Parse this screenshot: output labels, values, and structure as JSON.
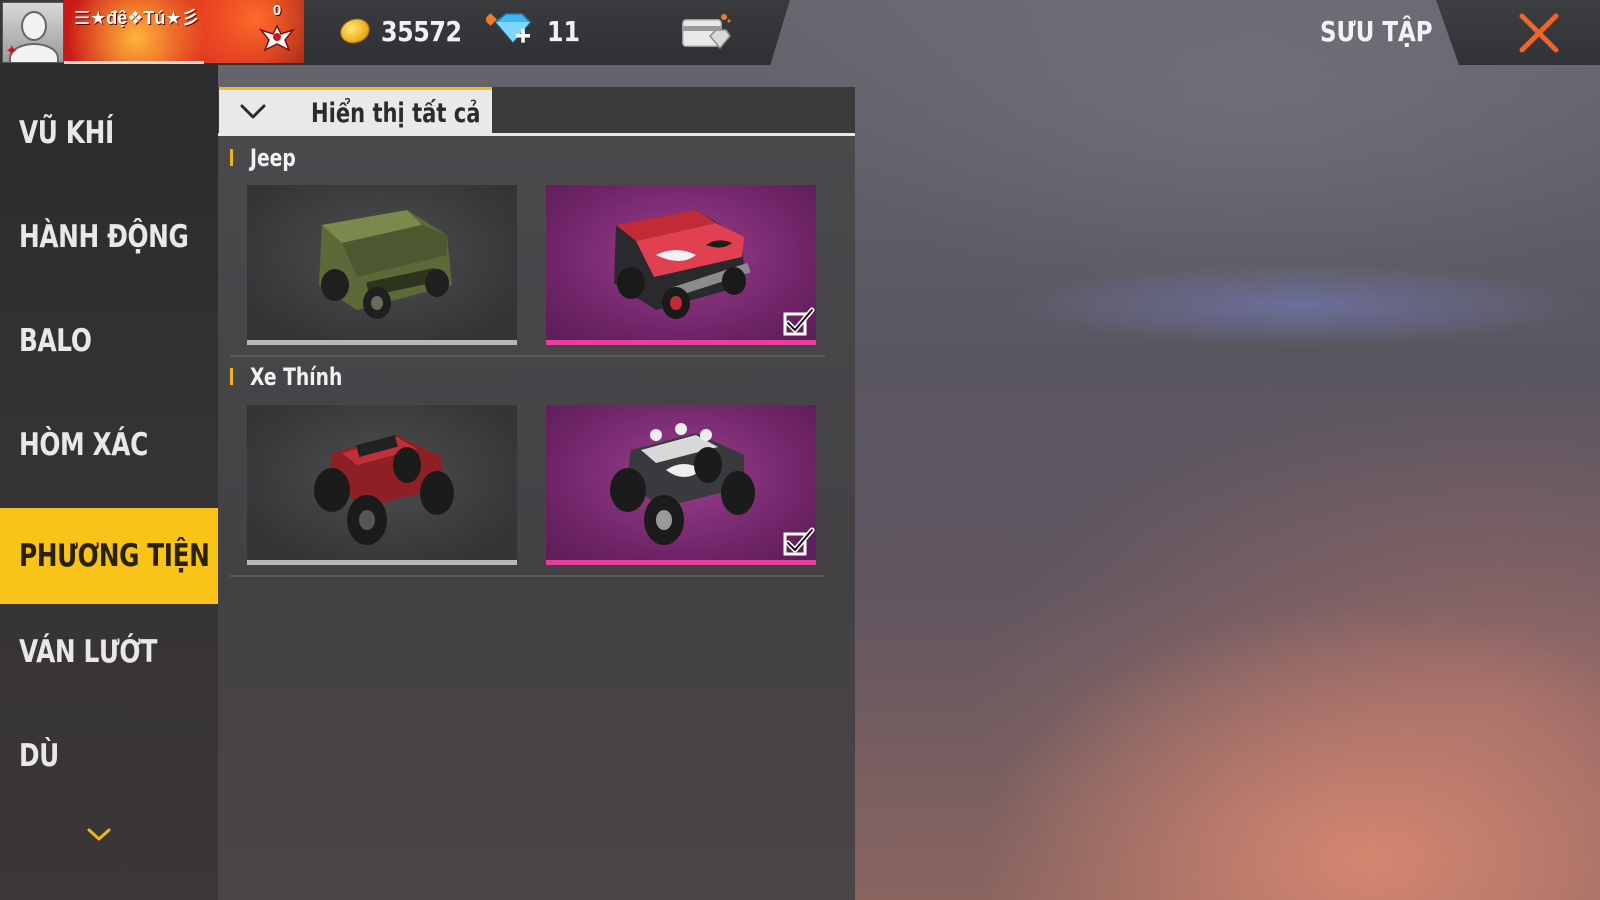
{
  "header": {
    "player_name": "☰★đệ❖Tú★彡",
    "badge_level": "0",
    "gold": "35572",
    "diamonds": "11",
    "screen_title": "SƯU TẬP"
  },
  "icons": {
    "gold": "gold-coin-icon",
    "diamond": "diamond-plus-icon",
    "card": "membership-card-icon",
    "close": "close-x-icon",
    "dropdown": "chevron-down-icon",
    "selected": "checkmark-icon"
  },
  "colors": {
    "accent": "#fac319",
    "close": "#f0642a",
    "rare_border": "#e6409a",
    "rare_bg": "#6d2366",
    "normal_border": "#b8b8b8"
  },
  "sidebar": {
    "items": [
      {
        "label": "VŨ KHÍ",
        "active": false
      },
      {
        "label": "HÀNH ĐỘNG",
        "active": false
      },
      {
        "label": "BALO",
        "active": false
      },
      {
        "label": "HÒM XÁC",
        "active": false
      },
      {
        "label": "PHƯƠNG TIỆN",
        "active": true
      },
      {
        "label": "VÁN LƯỚT",
        "active": false
      },
      {
        "label": "DÙ",
        "active": false
      }
    ]
  },
  "filter": {
    "label": "Hiển thị tất cả"
  },
  "sections": [
    {
      "title": "Jeep",
      "items": [
        {
          "name": "green-jeep",
          "rarity": "normal",
          "selected": false
        },
        {
          "name": "red-camo-jeep",
          "rarity": "rare",
          "selected": true
        }
      ]
    },
    {
      "title": "Xe Thính",
      "items": [
        {
          "name": "red-monster-truck",
          "rarity": "normal",
          "selected": false
        },
        {
          "name": "skull-monster-truck",
          "rarity": "rare",
          "selected": true
        }
      ]
    }
  ]
}
